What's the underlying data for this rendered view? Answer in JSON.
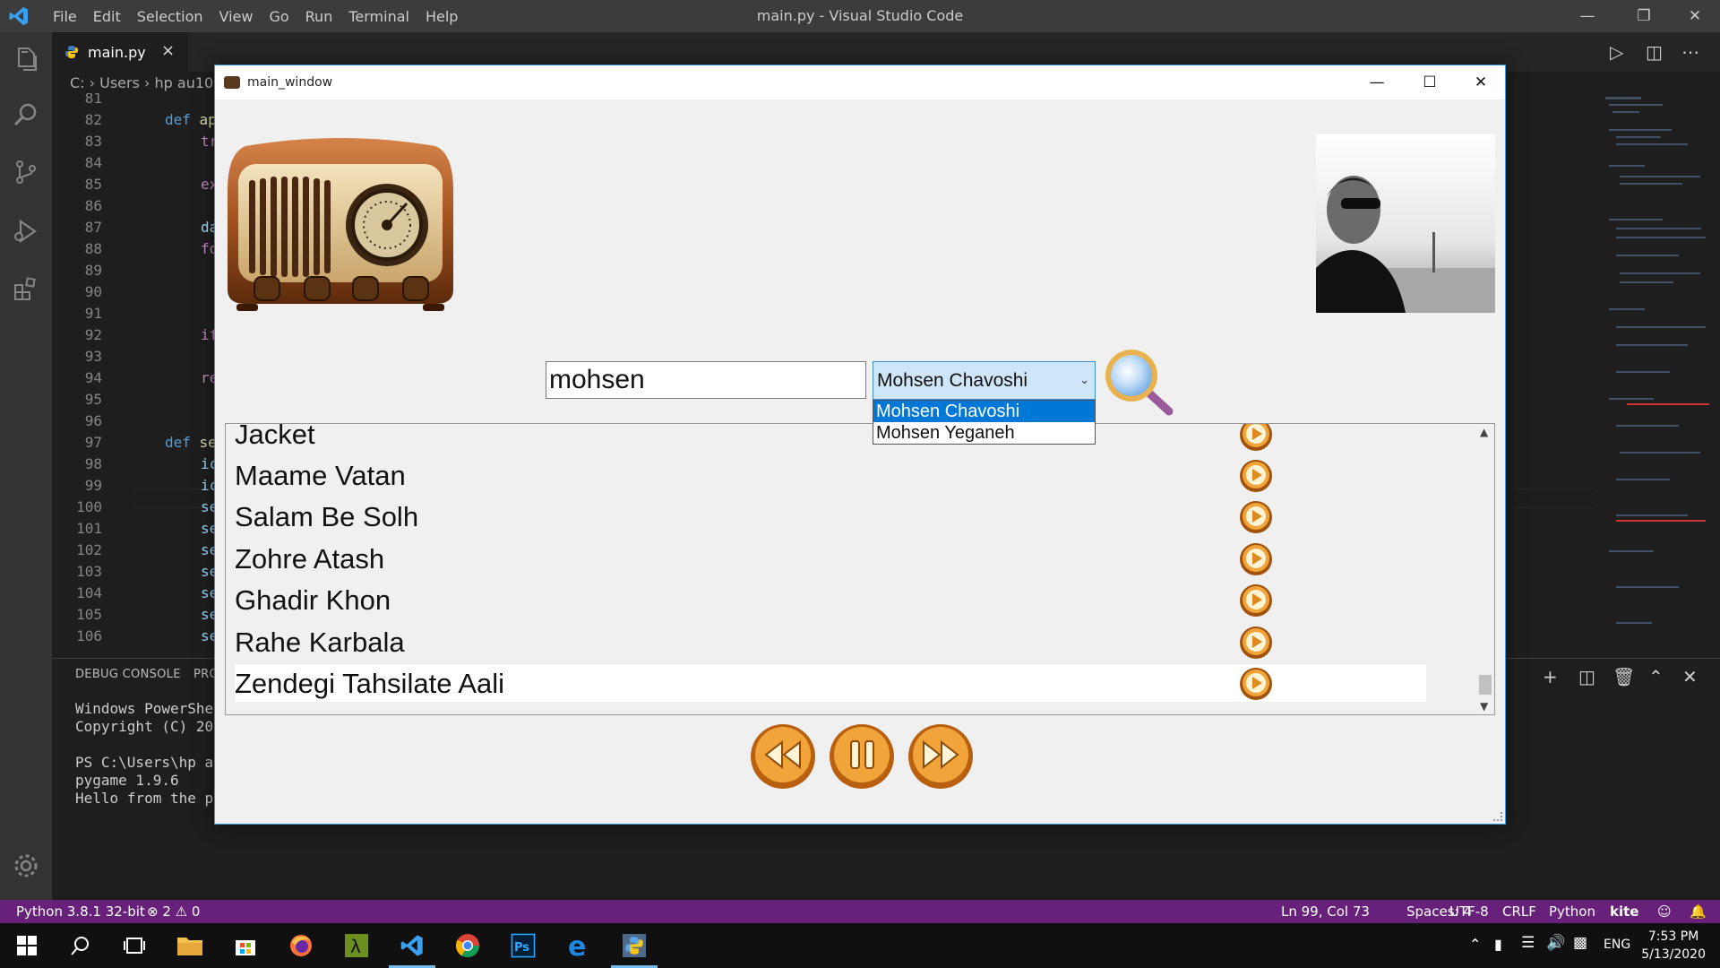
{
  "vscode": {
    "menu": [
      "File",
      "Edit",
      "Selection",
      "View",
      "Go",
      "Run",
      "Terminal",
      "Help"
    ],
    "window_title": "main.py - Visual Studio Code",
    "tab": {
      "label": "main.py",
      "close": "×"
    },
    "breadcrumb": "C: › Users › hp au105",
    "editor_lines": [
      {
        "n": "81",
        "code": ""
      },
      {
        "n": "82",
        "code": "def ap",
        "kw": true
      },
      {
        "n": "83",
        "code": "tr"
      },
      {
        "n": "84",
        "code": ""
      },
      {
        "n": "85",
        "code": "ex"
      },
      {
        "n": "86",
        "code": ""
      },
      {
        "n": "87",
        "code": "da"
      },
      {
        "n": "88",
        "code": "fo"
      },
      {
        "n": "89",
        "code": ""
      },
      {
        "n": "90",
        "code": ""
      },
      {
        "n": "91",
        "code": ""
      },
      {
        "n": "92",
        "code": "if"
      },
      {
        "n": "93",
        "code": ""
      },
      {
        "n": "94",
        "code": "re"
      },
      {
        "n": "95",
        "code": ""
      },
      {
        "n": "96",
        "code": ""
      },
      {
        "n": "97",
        "code": "def se",
        "kw": true
      },
      {
        "n": "98",
        "code": "ic"
      },
      {
        "n": "99",
        "code": "ic"
      },
      {
        "n": "100",
        "code": "se"
      },
      {
        "n": "101",
        "code": "se"
      },
      {
        "n": "102",
        "code": "se"
      },
      {
        "n": "103",
        "code": "se"
      },
      {
        "n": "104",
        "code": "se"
      },
      {
        "n": "105",
        "code": "se"
      },
      {
        "n": "106",
        "code": "se"
      }
    ],
    "panel": {
      "tab1": "DEBUG CONSOLE",
      "tab2": "PRO",
      "terminal_text": "Windows PowerShel\nCopyright (C) 201\n\nPS C:\\Users\\hp au\npygame 1.9.6\nHello from the py"
    },
    "status": {
      "python": "Python 3.8.1 32-bit",
      "problems": "⊗ 2 ⚠ 0",
      "position": "Ln 99, Col 73",
      "spaces": "Spaces: 4",
      "encoding": "UTF-8",
      "eol": "CRLF",
      "language": "Python",
      "kite": "kite"
    }
  },
  "taskbar": {
    "language": "ENG",
    "time": "7:53 PM",
    "date": "5/13/2020"
  },
  "app": {
    "title": "main_window",
    "search_value": "mohsen",
    "combo_selected": "Mohsen Chavoshi",
    "combo_options": [
      "Mohsen Chavoshi",
      "Mohsen Yeganeh"
    ],
    "songs": [
      "Jacket",
      "Maame Vatan",
      "Salam Be Solh",
      "Zohre Atash",
      "Ghadir Khon",
      "Rahe Karbala",
      "Zendegi Tahsilate Aali"
    ],
    "selected_song_index": 6
  },
  "colors": {
    "statusbar": "#68217a",
    "accent_blue": "#0078d7",
    "orange_button": "#e0891e"
  }
}
